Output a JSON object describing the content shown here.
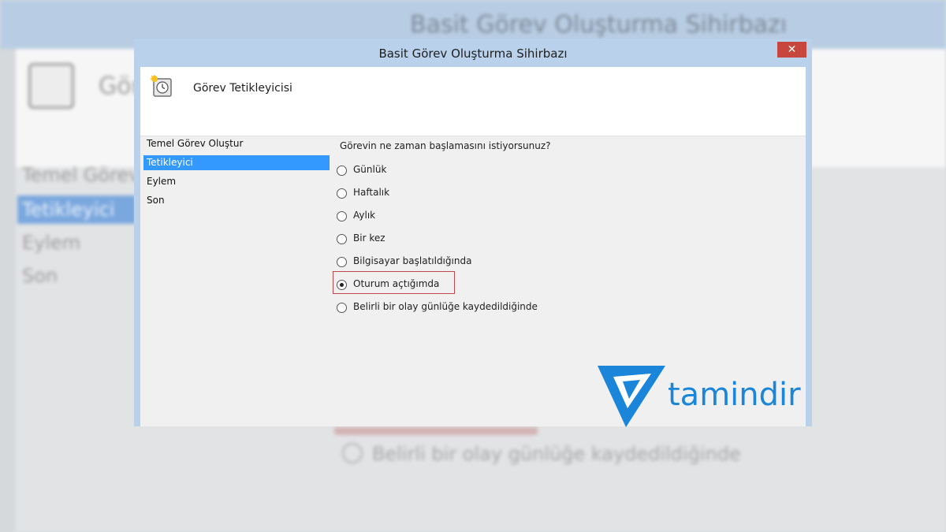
{
  "background": {
    "title": "Basit Görev Oluşturma Sihirbazı",
    "header": "Gör",
    "sidebar": [
      "Temel Görev O",
      "Tetikleyici",
      "Eylem",
      "Son"
    ],
    "option": "Belirli bir olay günlüğe kaydedildiğinde"
  },
  "dialog": {
    "title": "Basit Görev Oluşturma Sihirbazı",
    "close_label": "✕",
    "header_title": "Görev Tetikleyicisi",
    "sidebar": {
      "items": [
        "Temel Görev Oluştur",
        "Tetikleyici",
        "Eylem",
        "Son"
      ],
      "selected_index": 1
    },
    "question": "Görevin ne zaman başlamasını istiyorsunuz?",
    "options": [
      {
        "label": "Günlük",
        "checked": false
      },
      {
        "label": "Haftalık",
        "checked": false
      },
      {
        "label": "Aylık",
        "checked": false
      },
      {
        "label": "Bir kez",
        "checked": false
      },
      {
        "label": "Bilgisayar başlatıldığında",
        "checked": false
      },
      {
        "label": "Oturum açtığımda",
        "checked": true
      },
      {
        "label": "Belirli bir olay günlüğe kaydedildiğinde",
        "checked": false
      }
    ]
  },
  "watermark": {
    "text": "tamindir",
    "color": "#1b86d9"
  },
  "colors": {
    "selection": "#3399ff",
    "highlight_border": "#c0474b",
    "close_button": "#c7463d"
  }
}
